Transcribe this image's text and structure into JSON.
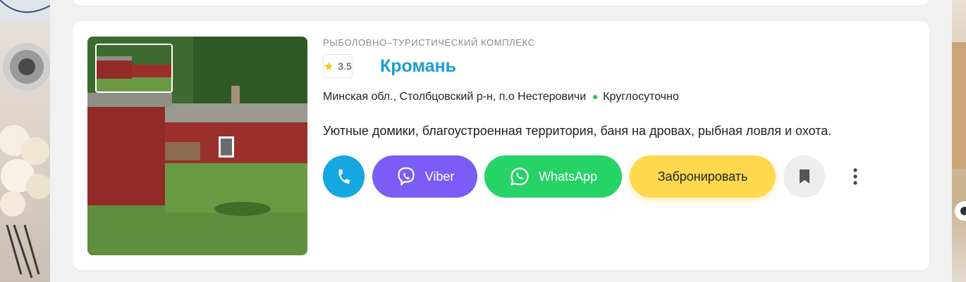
{
  "listing": {
    "category": "Рыболовно–туристический комплекс",
    "rating": "3.5",
    "title": "Кромань",
    "address": "Минская обл., Столбцовский р-н, п.о Нестеровичи",
    "hours": "Круглосуточно",
    "description": "Уютные домики, благоустроенная территория, баня на дровах, рыбная ловля и охота."
  },
  "actions": {
    "phone_icon": "phone-icon",
    "viber_label": "Viber",
    "whatsapp_label": "WhatsApp",
    "book_label": "Забронировать",
    "bookmark_icon": "bookmark-icon",
    "more_icon": "more-vertical-icon"
  },
  "colors": {
    "title": "#1a9fd2",
    "phone": "#14a7e0",
    "viber": "#7b5cf4",
    "whatsapp": "#25d366",
    "book": "#ffd84e",
    "open_dot": "#22c55e",
    "star": "#f5c518"
  }
}
